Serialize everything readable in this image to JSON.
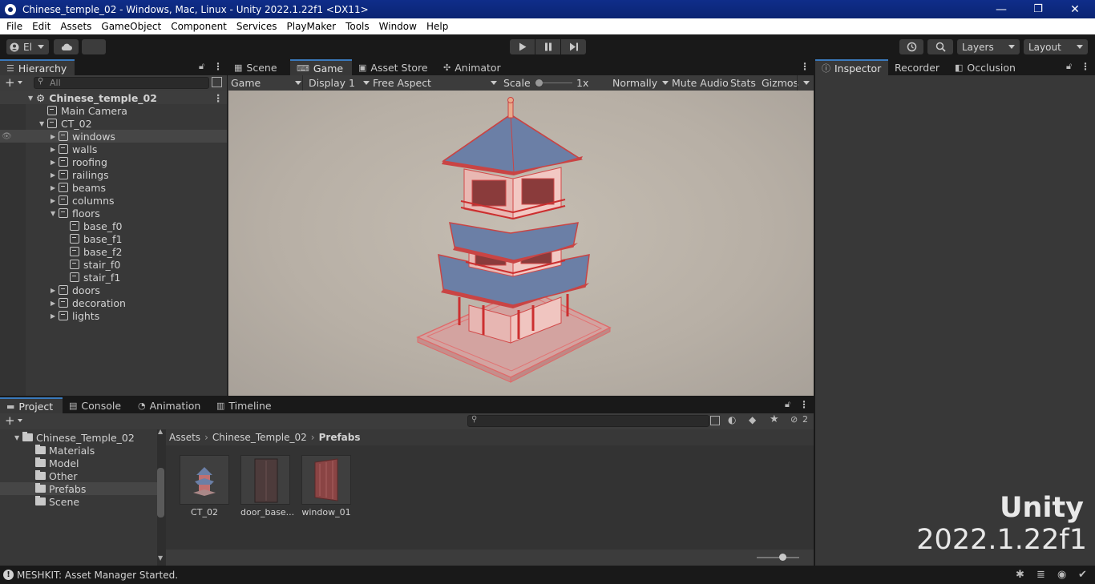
{
  "window": {
    "title": "Chinese_temple_02 - Windows, Mac, Linux - Unity 2022.1.22f1 <DX11>",
    "minimize": "—",
    "restore": "❐",
    "close": "✕"
  },
  "menu": [
    "File",
    "Edit",
    "Assets",
    "GameObject",
    "Component",
    "Services",
    "PlayMaker",
    "Tools",
    "Window",
    "Help"
  ],
  "toolbar": {
    "account_label": "El",
    "layers_label": "Layers",
    "layout_label": "Layout"
  },
  "hierarchy": {
    "tab_label": "Hierarchy",
    "search_placeholder": "All",
    "scene_name": "Chinese_temple_02",
    "items": [
      {
        "label": "Main Camera",
        "level": 1,
        "expandable": false,
        "expanded": false
      },
      {
        "label": "CT_02",
        "level": 1,
        "expandable": true,
        "expanded": true
      },
      {
        "label": "windows",
        "level": 2,
        "expandable": true,
        "expanded": false,
        "selected": true
      },
      {
        "label": "walls",
        "level": 2,
        "expandable": true,
        "expanded": false
      },
      {
        "label": "roofing",
        "level": 2,
        "expandable": true,
        "expanded": false
      },
      {
        "label": "railings",
        "level": 2,
        "expandable": true,
        "expanded": false
      },
      {
        "label": "beams",
        "level": 2,
        "expandable": true,
        "expanded": false
      },
      {
        "label": "columns",
        "level": 2,
        "expandable": true,
        "expanded": false
      },
      {
        "label": "floors",
        "level": 2,
        "expandable": true,
        "expanded": true
      },
      {
        "label": "base_f0",
        "level": 3,
        "expandable": false,
        "expanded": false
      },
      {
        "label": "base_f1",
        "level": 3,
        "expandable": false,
        "expanded": false
      },
      {
        "label": "base_f2",
        "level": 3,
        "expandable": false,
        "expanded": false
      },
      {
        "label": "stair_f0",
        "level": 3,
        "expandable": false,
        "expanded": false
      },
      {
        "label": "stair_f1",
        "level": 3,
        "expandable": false,
        "expanded": false
      },
      {
        "label": "doors",
        "level": 2,
        "expandable": true,
        "expanded": false
      },
      {
        "label": "decoration",
        "level": 2,
        "expandable": true,
        "expanded": false
      },
      {
        "label": "lights",
        "level": 2,
        "expandable": true,
        "expanded": false
      }
    ]
  },
  "center_tabs": [
    {
      "label": "Scene",
      "icon": "grid-icon",
      "active": false
    },
    {
      "label": "Game",
      "icon": "gamepad-icon",
      "active": true
    },
    {
      "label": "Asset Store",
      "icon": "bag-icon",
      "active": false
    },
    {
      "label": "Animator",
      "icon": "animator-icon",
      "active": false
    }
  ],
  "game_toolbar": {
    "mode": "Game",
    "display": "Display 1",
    "aspect": "Free Aspect",
    "scale_label": "Scale",
    "scale_value": "1x",
    "play_focus": "Normally",
    "mute": "Mute Audio",
    "stats": "Stats",
    "gizmos": "Gizmos"
  },
  "right_tabs": [
    {
      "label": "Inspector",
      "icon": "info-icon",
      "active": true
    },
    {
      "label": "Recorder",
      "icon": "",
      "active": false
    },
    {
      "label": "Occlusion",
      "icon": "occlusion-icon",
      "active": false
    }
  ],
  "bottom_tabs": [
    {
      "label": "Project",
      "icon": "folder-icon",
      "active": true
    },
    {
      "label": "Console",
      "icon": "console-icon",
      "active": false
    },
    {
      "label": "Animation",
      "icon": "clock-icon",
      "active": false
    },
    {
      "label": "Timeline",
      "icon": "film-icon",
      "active": false
    }
  ],
  "project": {
    "tree": [
      {
        "label": "Chinese_Temple_02",
        "level": 1,
        "selected": false
      },
      {
        "label": "Materials",
        "level": 2,
        "selected": false
      },
      {
        "label": "Model",
        "level": 2,
        "selected": false
      },
      {
        "label": "Other",
        "level": 2,
        "selected": false
      },
      {
        "label": "Prefabs",
        "level": 2,
        "selected": true
      },
      {
        "label": "Scene",
        "level": 2,
        "selected": false
      }
    ],
    "breadcrumb": [
      "Assets",
      "Chinese_Temple_02",
      "Prefabs"
    ],
    "hidden_count": "2",
    "assets": [
      {
        "label": "CT_02",
        "icon": "temple-prefab-icon"
      },
      {
        "label": "door_base...",
        "icon": "door-prefab-icon"
      },
      {
        "label": "window_01",
        "icon": "window-prefab-icon"
      }
    ]
  },
  "watermark": {
    "line1": "Unity",
    "line2": "2022.1.22f1"
  },
  "status": {
    "message": "MESHKIT: Asset Manager Started."
  }
}
